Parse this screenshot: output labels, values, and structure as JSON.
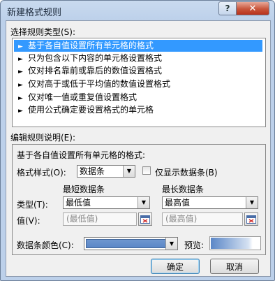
{
  "window": {
    "title": "新建格式规则",
    "help_label": "?",
    "close_label": "✕"
  },
  "rule_type": {
    "label": "选择规则类型(S):",
    "items": [
      "基于各自值设置所有单元格的格式",
      "只为包含以下内容的单元格设置格式",
      "仅对排名靠前或靠后的数值设置格式",
      "仅对高于或低于平均值的数值设置格式",
      "仅对唯一值或重复值设置格式",
      "使用公式确定要设置格式的单元格"
    ],
    "selected_index": 0
  },
  "edit": {
    "label": "编辑规则说明(E):",
    "heading": "基于各自值设置所有单元格的格式:",
    "format_style_label": "格式样式(O):",
    "format_style_value": "数据条",
    "show_bar_only_label": "仅显示数据条(B)",
    "show_bar_only_checked": false,
    "min_header": "最短数据条",
    "max_header": "最长数据条",
    "type_label": "类型(T):",
    "value_label": "值(V):",
    "min_type_value": "最低值",
    "max_type_value": "最高值",
    "min_value_placeholder": "(最低值)",
    "max_value_placeholder": "(最高值)",
    "bar_color_label": "数据条颜色(C):",
    "bar_color": "#5b87c7",
    "preview_label": "预览:"
  },
  "buttons": {
    "ok": "确定",
    "cancel": "取消"
  }
}
